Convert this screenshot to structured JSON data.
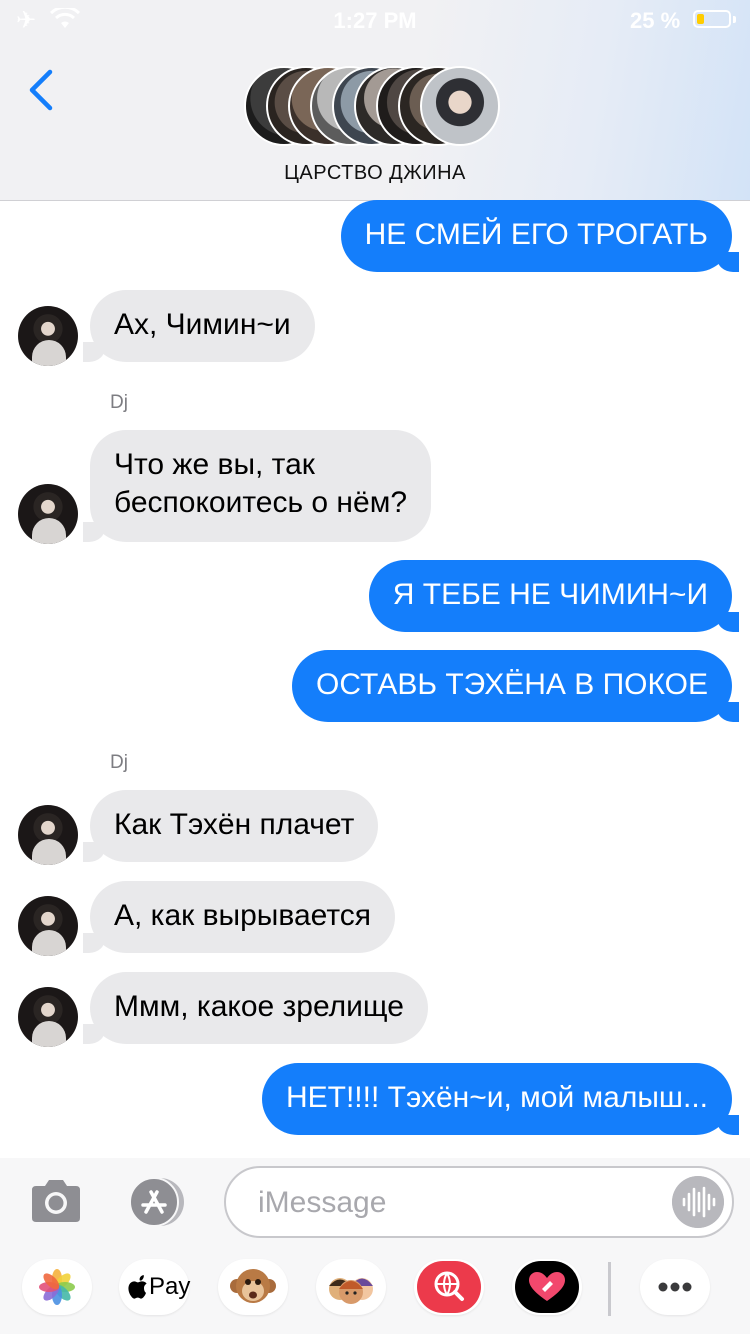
{
  "status_bar": {
    "time": "1:27 PM",
    "battery_percent": "25 %",
    "battery_level": 0.25
  },
  "header": {
    "group_name": "ЦАРСТВО ДЖИНА",
    "back_icon": "chevron-left-icon"
  },
  "messages": [
    {
      "dir": "out",
      "text": "НЕ СМЕЙ ЕГО ТРОГАТЬ"
    },
    {
      "dir": "in",
      "text": "Ах, Чимин~и"
    },
    {
      "sender": "Dj"
    },
    {
      "dir": "in",
      "lines": [
        "Что же вы, так",
        "беспокоитесь о нём?"
      ]
    },
    {
      "dir": "out",
      "text": "Я ТЕБЕ НЕ ЧИМИН~И"
    },
    {
      "dir": "out",
      "text": "ОСТАВЬ ТЭХЁНА В ПОКОЕ"
    },
    {
      "sender": "Dj"
    },
    {
      "dir": "in",
      "text": "Как Тэхён плачет"
    },
    {
      "dir": "in",
      "text": "А, как вырывается"
    },
    {
      "dir": "in",
      "text": "Ммм, какое зрелище"
    },
    {
      "dir": "out",
      "text": "НЕТ!!!! Тэхён~и, мой малыш..."
    }
  ],
  "input": {
    "placeholder": "iMessage"
  },
  "apps": [
    {
      "name": "photos",
      "icon": "photos-icon"
    },
    {
      "name": "apple-pay",
      "icon": "apple-icon",
      "label": "Pay"
    },
    {
      "name": "animoji",
      "icon": "monkey-icon"
    },
    {
      "name": "memoji",
      "icon": "memoji-icon"
    },
    {
      "name": "search",
      "icon": "globe-search-icon"
    },
    {
      "name": "digital-touch",
      "icon": "heart-icon"
    },
    {
      "name": "more",
      "icon": "more-icon"
    }
  ],
  "colors": {
    "outgoing": "#147efb",
    "incoming": "#e9e9eb",
    "accent": "#147efb"
  }
}
